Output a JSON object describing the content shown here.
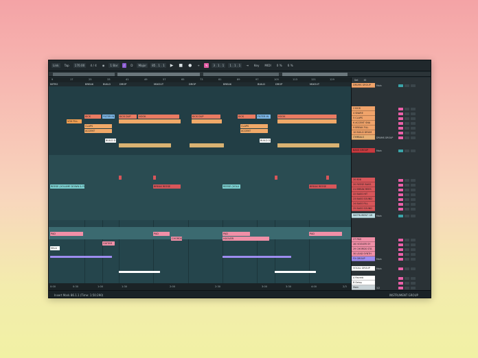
{
  "transport": {
    "link": "Link",
    "tap": "Tap",
    "tempo": "170.00",
    "time_sig": "4 / 4",
    "metronome": "1 Bar",
    "key_root": "D",
    "scale": "Major",
    "position": "85 . 1 . 1",
    "loop_start": "3 . 1 . 1",
    "loop_length": "1 . 1 . 1",
    "key_label": "Key",
    "midi_label": "MIDI",
    "cpu": "0 %",
    "zoom": "6 %"
  },
  "ruler": [
    "9",
    "17",
    "25",
    "33",
    "41",
    "49",
    "57",
    "65",
    "73",
    "81",
    "89",
    "97",
    "105",
    "113",
    "121",
    "129"
  ],
  "locators": [
    "INTRO",
    "BREAK",
    "BUILD",
    "DROP",
    "MIXOUT",
    "DROP",
    "BREAK",
    "BUILD",
    "DROP",
    "MIXOUT"
  ],
  "clips": {
    "filter": "FILTER IN",
    "kick": "KICK",
    "kick_dup": "KICK DUP",
    "hook": "HOOK",
    "vox_fill": "VOX FILL",
    "claps": "CLAPS",
    "accent": "ACCENT",
    "build": "BUILD D",
    "reese": "REESE (VOLUME DOWN & FILTER)",
    "reese_short": "REESE (VOLU",
    "break_reese": "BREAK REESE",
    "pad": "PAD",
    "guitar": "GUITAR",
    "chords": "CHORDS",
    "skla": "SKLA",
    "hoover": "HOOVER"
  },
  "time_axis": [
    "0:00",
    "0:30",
    "1:00",
    "1:30",
    "2:00",
    "2:30",
    "3:00",
    "3:30",
    "4:00"
  ],
  "page_counter": "2/3",
  "mixer": {
    "header_label": "Set",
    "io": "IO",
    "tracks": [
      {
        "name": "DRUMS GROUP",
        "route": "Main",
        "color": "#f0a36a"
      },
      {
        "name": "2 KICK",
        "route": "",
        "color": "#f0a36a"
      },
      {
        "name": "4 SNARE",
        "route": "",
        "color": "#f0a36a"
      },
      {
        "name": "5 CLAPS",
        "route": "",
        "color": "#f0a36a"
      },
      {
        "name": "6 ACCENT SNA",
        "route": "",
        "color": "#f0a36a"
      },
      {
        "name": "9 BREAK FILL",
        "route": "",
        "color": "#f0a36a"
      },
      {
        "name": "10 BUILD DRUM",
        "route": "",
        "color": "#f0a36a"
      },
      {
        "name": "CYMBALS",
        "route": "DRUMS GROUP",
        "color": "#e7b074"
      },
      {
        "name": "BASS GROUP",
        "route": "Main",
        "color": "#c93a3f"
      },
      {
        "name": "20 808",
        "route": "",
        "color": "#d8565a"
      },
      {
        "name": "20 REESE BASS",
        "route": "",
        "color": "#d8565a"
      },
      {
        "name": "21 BREAK REES",
        "route": "",
        "color": "#d8565a"
      },
      {
        "name": "22 BASS HIT",
        "route": "",
        "color": "#d8565a"
      },
      {
        "name": "23 BASS SOUND",
        "route": "",
        "color": "#d8565a"
      },
      {
        "name": "24 BASS FILL",
        "route": "",
        "color": "#d8565a"
      },
      {
        "name": "25 BASS SOUND",
        "route": "",
        "color": "#d8565a"
      },
      {
        "name": "INSTRUMENT GR",
        "route": "Main",
        "color": "#bfe0e6"
      },
      {
        "name": "27 PAD",
        "route": "",
        "color": "#f08fa7"
      },
      {
        "name": "28 HOOVER SY",
        "route": "",
        "color": "#f08fa7"
      },
      {
        "name": "29 CHORDS STA",
        "route": "",
        "color": "#f08fa7"
      },
      {
        "name": "30 LEAD SYNTH",
        "route": "",
        "color": "#f08fa7"
      },
      {
        "name": "FX GROUP",
        "route": "Main",
        "color": "#9d8cf0"
      },
      {
        "name": "VOCAL GROUP",
        "route": "Main",
        "color": "#ffffff"
      },
      {
        "name": "A Reverb",
        "route": "",
        "color": "#ffffff"
      },
      {
        "name": "B Delay",
        "route": "",
        "color": "#ffffff"
      },
      {
        "name": "Main",
        "route": "1/2",
        "color": "#c9d3d7"
      }
    ]
  },
  "status": {
    "message": "Insert Mark 86.1.1 (Time: 1:50:290)",
    "instrument_group": "INSTRUMENT GROUP"
  }
}
